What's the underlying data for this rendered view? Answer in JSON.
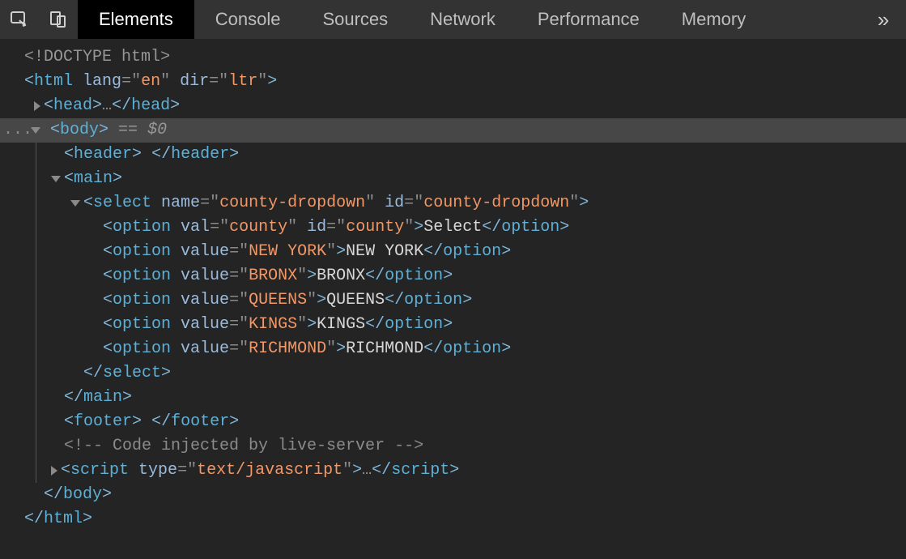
{
  "tabs": {
    "elements": "Elements",
    "console": "Console",
    "sources": "Sources",
    "network": "Network",
    "performance": "Performance",
    "memory": "Memory",
    "overflow": "»"
  },
  "dom": {
    "ellipsis": "...",
    "doctype": {
      "open": "<",
      "bang": "!",
      "name": "DOCTYPE html",
      "close": ">"
    },
    "html": {
      "open": "<",
      "tag": "html",
      "sp": " ",
      "a1n": "lang",
      "eq": "=",
      "q": "\"",
      "a1v": "en",
      "a2n": "dir",
      "a2v": "ltr",
      "close": ">"
    },
    "head": {
      "open": "<",
      "tag": "head",
      "close": ">",
      "dots": "…",
      "copen": "</",
      "cclose": ">"
    },
    "body": {
      "open": "<",
      "tag": "body",
      "close": ">",
      "eqmark": " == ",
      "dollar": "$0",
      "copen": "</",
      "cclose": ">"
    },
    "header": {
      "open": "<",
      "tag": "header",
      "close": ">",
      "sp": " ",
      "copen": "</",
      "cclose": ">"
    },
    "main": {
      "open": "<",
      "tag": "main",
      "close": ">",
      "copen": "</",
      "cclose": ">"
    },
    "select": {
      "open": "<",
      "tag": "select",
      "sp": " ",
      "a1n": "name",
      "eq": "=",
      "q": "\"",
      "a1v": "county-dropdown",
      "a2n": "id",
      "a2v": "county-dropdown",
      "close": ">",
      "copen": "</",
      "cclose": ">"
    },
    "opt0": {
      "open": "<",
      "tag": "option",
      "sp": " ",
      "a1n": "val",
      "eq": "=",
      "q": "\"",
      "a1v": "county",
      "a2n": "id",
      "a2v": "county",
      "close": ">",
      "txt": "Select",
      "copen": "</",
      "cclose": ">"
    },
    "opt1": {
      "open": "<",
      "tag": "option",
      "sp": " ",
      "a1n": "value",
      "eq": "=",
      "q": "\"",
      "a1v": "NEW YORK",
      "close": ">",
      "txt": "NEW YORK",
      "copen": "</",
      "cclose": ">"
    },
    "opt2": {
      "open": "<",
      "tag": "option",
      "sp": " ",
      "a1n": "value",
      "eq": "=",
      "q": "\"",
      "a1v": "BRONX",
      "close": ">",
      "txt": "BRONX",
      "copen": "</",
      "cclose": ">"
    },
    "opt3": {
      "open": "<",
      "tag": "option",
      "sp": " ",
      "a1n": "value",
      "eq": "=",
      "q": "\"",
      "a1v": "QUEENS",
      "close": ">",
      "txt": "QUEENS",
      "copen": "</",
      "cclose": ">"
    },
    "opt4": {
      "open": "<",
      "tag": "option",
      "sp": " ",
      "a1n": "value",
      "eq": "=",
      "q": "\"",
      "a1v": "KINGS",
      "close": ">",
      "txt": "KINGS",
      "copen": "</",
      "cclose": ">"
    },
    "opt5": {
      "open": "<",
      "tag": "option",
      "sp": " ",
      "a1n": "value",
      "eq": "=",
      "q": "\"",
      "a1v": "RICHMOND",
      "close": ">",
      "txt": "RICHMOND",
      "copen": "</",
      "cclose": ">"
    },
    "footer": {
      "open": "<",
      "tag": "footer",
      "close": ">",
      "sp": " ",
      "copen": "</",
      "cclose": ">"
    },
    "commenttxt": "<!-- Code injected by live-server -->",
    "script": {
      "open": "<",
      "tag": "script",
      "sp": " ",
      "a1n": "type",
      "eq": "=",
      "q": "\"",
      "a1v": "text/javascript",
      "close": ">",
      "dots": "…",
      "copen": "</",
      "cclose": ">"
    },
    "htmlclose": {
      "copen": "</",
      "tag": "html",
      "cclose": ">"
    }
  }
}
